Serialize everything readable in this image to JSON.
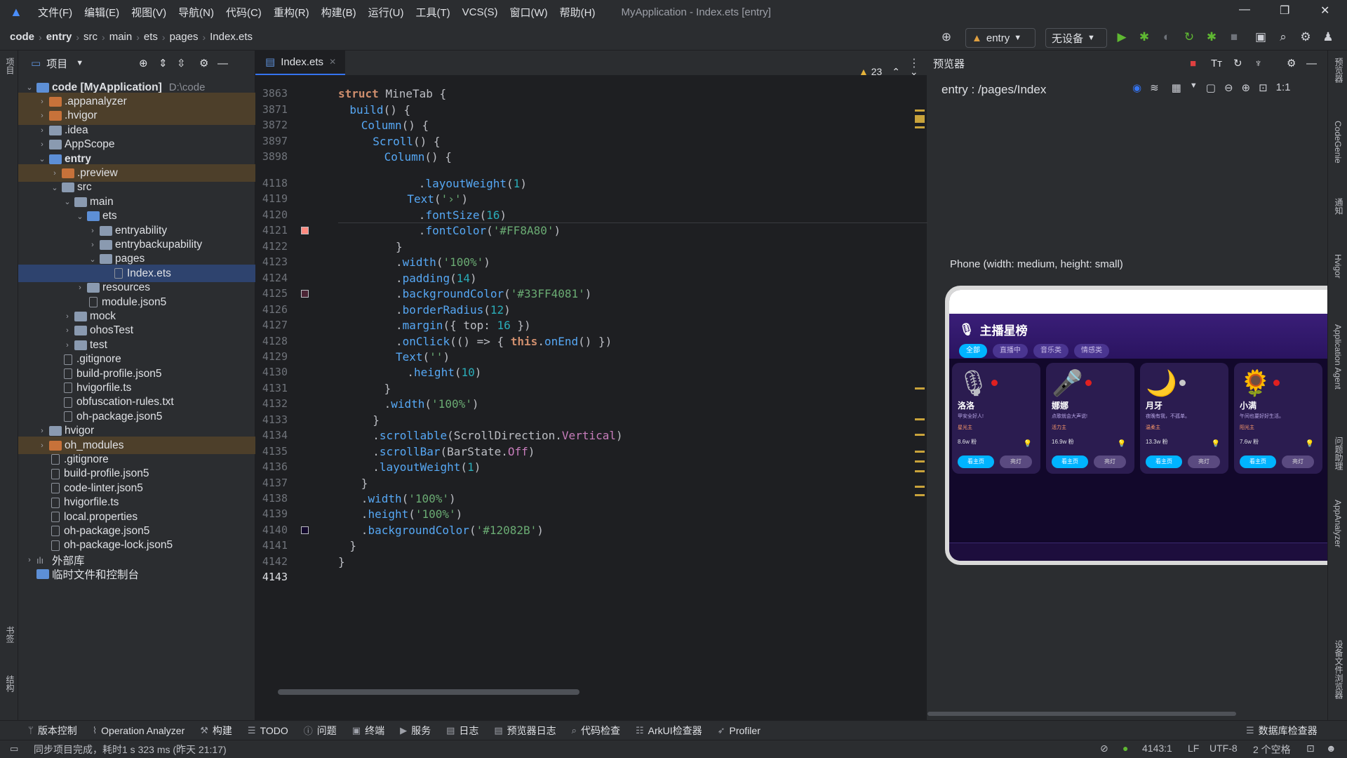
{
  "window": {
    "title": "MyApplication - Index.ets [entry]",
    "menu": [
      "文件(F)",
      "编辑(E)",
      "视图(V)",
      "导航(N)",
      "代码(C)",
      "重构(R)",
      "构建(B)",
      "运行(U)",
      "工具(T)",
      "VCS(S)",
      "窗口(W)",
      "帮助(H)"
    ]
  },
  "breadcrumb": [
    "code",
    "entry",
    "src",
    "main",
    "ets",
    "pages",
    "Index.ets"
  ],
  "toolbar": {
    "module": "entry",
    "device": "无设备"
  },
  "project": {
    "header": "项目",
    "root": {
      "name": "code [MyApplication]",
      "path": "D:\\code"
    },
    "items": [
      ".appanalyzer",
      ".hvigor",
      ".idea",
      "AppScope",
      "entry",
      ".preview",
      "src",
      "main",
      "ets",
      "entryability",
      "entrybackupability",
      "pages",
      "Index.ets",
      "resources",
      "module.json5",
      "mock",
      "ohosTest",
      "test",
      ".gitignore",
      "build-profile.json5",
      "hvigorfile.ts",
      "obfuscation-rules.txt",
      "oh-package.json5",
      "hvigor",
      "oh_modules",
      ".gitignore",
      "build-profile.json5",
      "code-linter.json5",
      "hvigorfile.ts",
      "local.properties",
      "oh-package.json5",
      "oh-package-lock.json5",
      "外部库",
      "临时文件和控制台"
    ]
  },
  "editor": {
    "tab": "Index.ets",
    "warnings": "23",
    "line_numbers": [
      "3863",
      "3871",
      "3872",
      "3897",
      "3898",
      "4118",
      "4119",
      "4120",
      "4121",
      "4122",
      "4123",
      "4124",
      "4125",
      "4126",
      "4127",
      "4128",
      "4129",
      "4130",
      "4131",
      "4132",
      "4133",
      "4134",
      "4135",
      "4136",
      "4137",
      "4138",
      "4139",
      "4140",
      "4141",
      "4142",
      "4143"
    ]
  },
  "preview": {
    "panel_title": "预览器",
    "path": "entry : /pages/Index",
    "device_label": "Phone (width: medium, height: small)",
    "app_title": "主播星榜",
    "chips": [
      "全部",
      "直播中",
      "音乐类",
      "情感类"
    ],
    "cards": [
      {
        "name": "洛洛",
        "desc": "甲安全好人!",
        "tag": "星光主",
        "count": "8.6w 粉",
        "btn1": "看主页",
        "btn2": "亮灯"
      },
      {
        "name": "娜娜",
        "desc": "点歌就会大声说!",
        "tag": "活力主",
        "count": "16.9w 粉",
        "btn1": "看主页",
        "btn2": "亮灯"
      },
      {
        "name": "月牙",
        "desc": "夜晚有我，不孤单。",
        "tag": "温柔主",
        "count": "13.3w 粉",
        "btn1": "看主页",
        "btn2": "亮灯"
      },
      {
        "name": "小满",
        "desc": "午间也要好好生活。",
        "tag": "阳光主",
        "count": "7.6w 粉",
        "btn1": "看主页",
        "btn2": "亮灯"
      }
    ]
  },
  "right_strip": [
    "预览器",
    "CodeGenie",
    "通知",
    "Hvigor",
    "Application Agent",
    "问题助理",
    "AppAnalyzer",
    "设备文件浏览器"
  ],
  "left_strip": [
    "项目",
    "书签",
    "结构"
  ],
  "tool_windows": [
    "版本控制",
    "Operation Analyzer",
    "构建",
    "TODO",
    "问题",
    "终端",
    "服务",
    "日志",
    "预览器日志",
    "代码检查",
    "ArkUI检查器",
    "Profiler",
    "数据库检查器"
  ],
  "status": {
    "message": "同步项目完成，耗时1 s 323 ms (昨天 21:17)",
    "position": "4143:1",
    "line_sep": "LF",
    "encoding": "UTF-8",
    "indent": "2 个空格"
  },
  "colors": {
    "accent": "#3574f0",
    "bg_editor": "#1e1f22",
    "bg_panel": "#2b2d30",
    "app_bg": "#12082b"
  }
}
